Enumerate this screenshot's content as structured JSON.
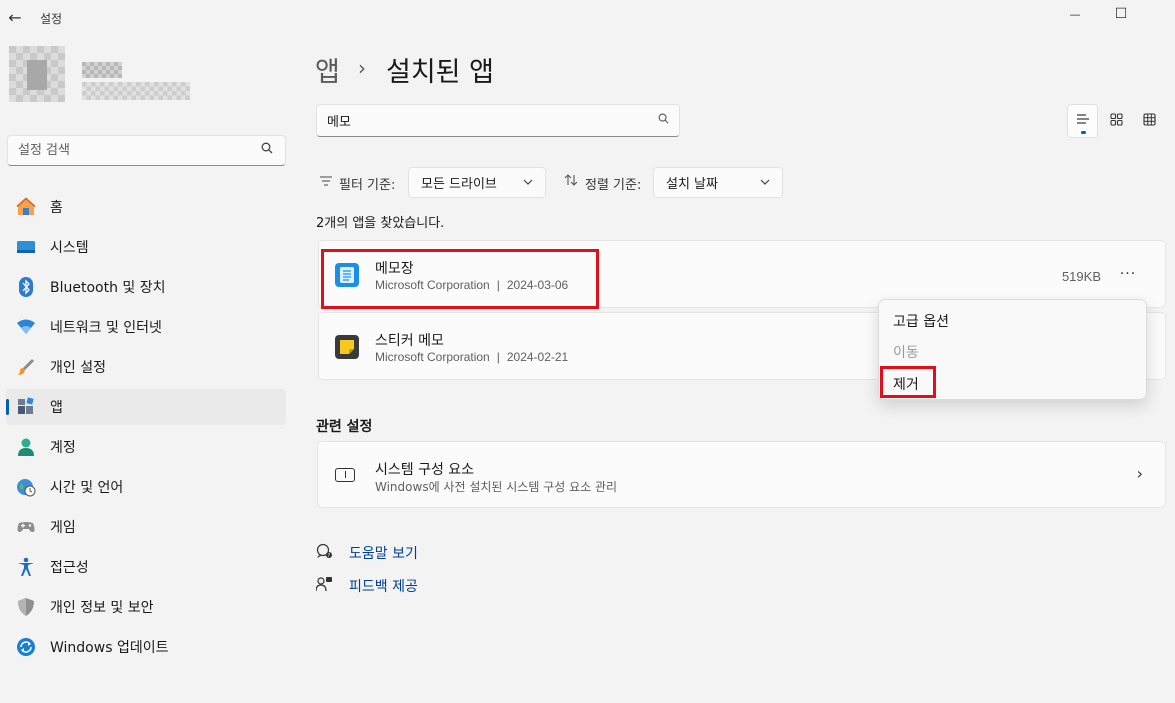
{
  "window": {
    "title": "설정",
    "back_icon": "←",
    "minimize_icon": "—",
    "maximize_icon": "☐"
  },
  "sidebar": {
    "search_placeholder": "설정 검색",
    "items": [
      {
        "label": "홈",
        "icon": "home-icon"
      },
      {
        "label": "시스템",
        "icon": "system-icon"
      },
      {
        "label": "Bluetooth 및 장치",
        "icon": "bluetooth-icon"
      },
      {
        "label": "네트워크 및 인터넷",
        "icon": "wifi-icon"
      },
      {
        "label": "개인 설정",
        "icon": "brush-icon"
      },
      {
        "label": "앱",
        "icon": "apps-icon",
        "active": true
      },
      {
        "label": "계정",
        "icon": "account-icon"
      },
      {
        "label": "시간 및 언어",
        "icon": "globe-icon"
      },
      {
        "label": "게임",
        "icon": "gamepad-icon"
      },
      {
        "label": "접근성",
        "icon": "accessibility-icon"
      },
      {
        "label": "개인 정보 및 보안",
        "icon": "shield-icon"
      },
      {
        "label": "Windows 업데이트",
        "icon": "update-icon"
      }
    ]
  },
  "header": {
    "parent": "앱",
    "separator": "›",
    "current": "설치된 앱"
  },
  "app_search": {
    "value": "메모"
  },
  "filters": {
    "filter_label": "필터 기준:",
    "filter_value": "모든 드라이브",
    "sort_label": "정렬 기준:",
    "sort_value": "설치 날짜"
  },
  "results_text": "2개의 앱을 찾았습니다.",
  "apps": [
    {
      "name": "메모장",
      "publisher": "Microsoft Corporation",
      "date": "2024-03-06",
      "size": "519KB",
      "more": "···"
    },
    {
      "name": "스티커 메모",
      "publisher": "Microsoft Corporation",
      "date": "2024-02-21"
    }
  ],
  "meta_separator": "|",
  "context_menu": {
    "items": [
      {
        "label": "고급 옵션",
        "enabled": true
      },
      {
        "label": "이동",
        "enabled": false
      },
      {
        "label": "제거",
        "enabled": true
      }
    ]
  },
  "related": {
    "title": "관련 설정",
    "card_title": "시스템 구성 요소",
    "card_subtitle": "Windows에 사전 설치된 시스템 구성 요소 관리",
    "chevron": "›"
  },
  "help": {
    "get_help": "도움말 보기",
    "feedback": "피드백 제공"
  },
  "colors": {
    "accent": "#005fb8",
    "highlight": "#e0101a",
    "link": "#003e92"
  }
}
